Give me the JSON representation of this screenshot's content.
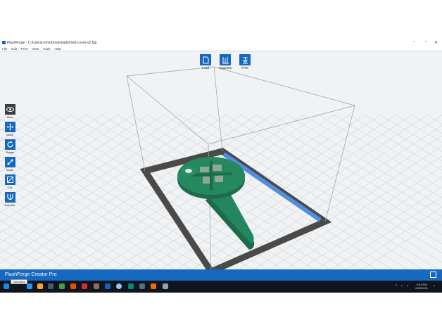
{
  "window": {
    "title": "FlashForge - C:/Users/John/Downloads/rivet-cover-v2.fpp",
    "minimize": "−",
    "maximize": "▫",
    "close": "✕"
  },
  "menu": [
    "File",
    "Edit",
    "Print",
    "View",
    "Tools",
    "Help"
  ],
  "topbar": [
    {
      "label": "Load",
      "icon": "file-icon"
    },
    {
      "label": "Supports",
      "icon": "supports-icon"
    },
    {
      "label": "Print",
      "icon": "print-icon"
    }
  ],
  "tools": [
    {
      "label": "View",
      "icon": "eye-icon",
      "active": true
    },
    {
      "label": "Move",
      "icon": "move-icon",
      "active": false
    },
    {
      "label": "Rotate",
      "icon": "rotate-icon",
      "active": false
    },
    {
      "label": "Scale",
      "icon": "scale-icon",
      "active": false
    },
    {
      "label": "Cut",
      "icon": "cut-icon",
      "active": false
    },
    {
      "label": "Extruder",
      "icon": "extruder-icon",
      "active": false
    }
  ],
  "status": {
    "machine": "FlashForge Creator Pro"
  },
  "taskbar": {
    "tooltip": "Calculator",
    "time": "9:44 PM",
    "date": "6/28/2021"
  },
  "colors": {
    "accent": "#1669c1",
    "model": "#1f7a57",
    "plate": "#4a4a4a",
    "plate_highlight": "#4f8ee0",
    "background": "#f0f2f4"
  }
}
